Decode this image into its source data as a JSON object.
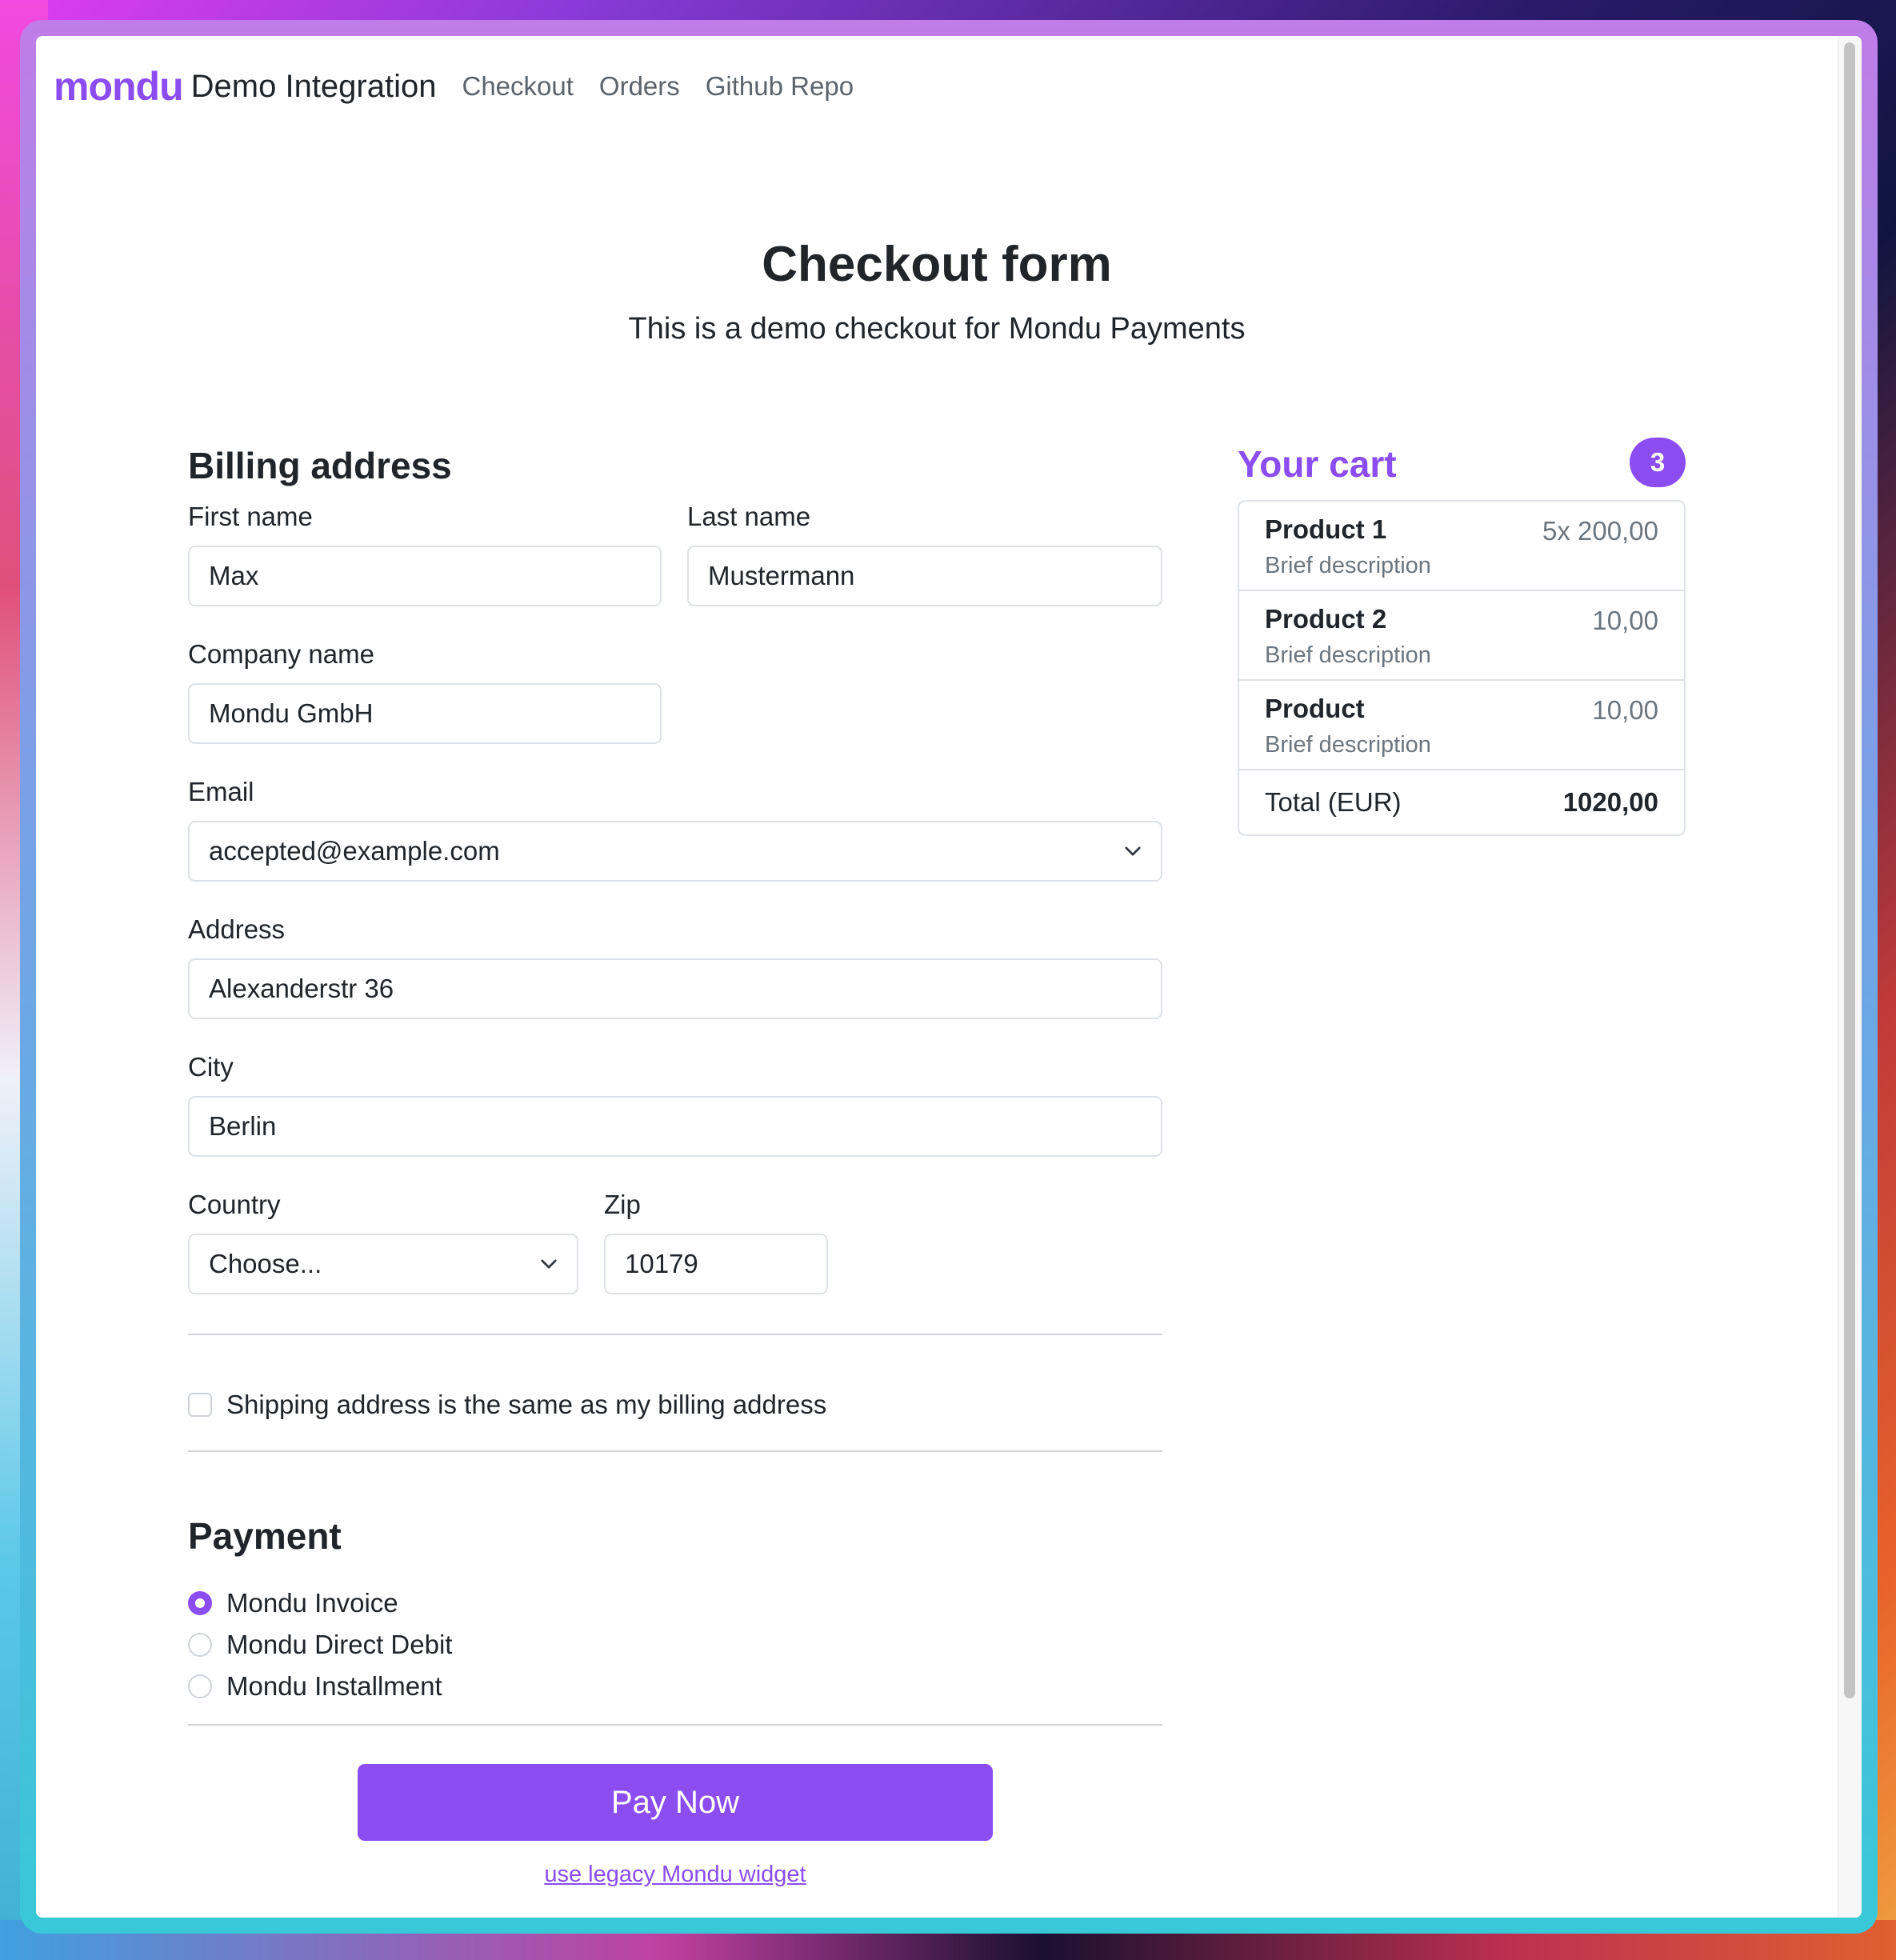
{
  "nav": {
    "logo": "mondu",
    "brand": "Demo Integration",
    "links": [
      "Checkout",
      "Orders",
      "Github Repo"
    ]
  },
  "hero": {
    "title": "Checkout form",
    "subtitle": "This is a demo checkout for Mondu Payments"
  },
  "billing": {
    "heading": "Billing address",
    "first_name": {
      "label": "First name",
      "value": "Max"
    },
    "last_name": {
      "label": "Last name",
      "value": "Mustermann"
    },
    "company": {
      "label": "Company name",
      "value": "Mondu GmbH"
    },
    "email": {
      "label": "Email",
      "value": "accepted@example.com"
    },
    "address": {
      "label": "Address",
      "value": "Alexanderstr 36"
    },
    "city": {
      "label": "City",
      "value": "Berlin"
    },
    "country": {
      "label": "Country",
      "value": "Choose..."
    },
    "zip": {
      "label": "Zip",
      "value": "10179"
    },
    "same_shipping": {
      "label": "Shipping address is the same as my billing address",
      "checked": false
    }
  },
  "payment": {
    "heading": "Payment",
    "options": [
      {
        "label": "Mondu Invoice",
        "checked": true
      },
      {
        "label": "Mondu Direct Debit",
        "checked": false
      },
      {
        "label": "Mondu Installment",
        "checked": false
      }
    ],
    "pay_button": "Pay Now",
    "legacy_link": "use legacy Mondu widget"
  },
  "cart": {
    "title": "Your cart",
    "count": "3",
    "items": [
      {
        "name": "Product 1",
        "description": "Brief description",
        "price": "5x 200,00"
      },
      {
        "name": "Product 2",
        "description": "Brief description",
        "price": "10,00"
      },
      {
        "name": "Product",
        "description": "Brief description",
        "price": "10,00"
      }
    ],
    "total_label": "Total (EUR)",
    "total_value": "1020,00"
  },
  "colors": {
    "accent": "#8b4cf0",
    "text": "#212529",
    "muted": "#6c757d",
    "border": "#dee2e6"
  }
}
